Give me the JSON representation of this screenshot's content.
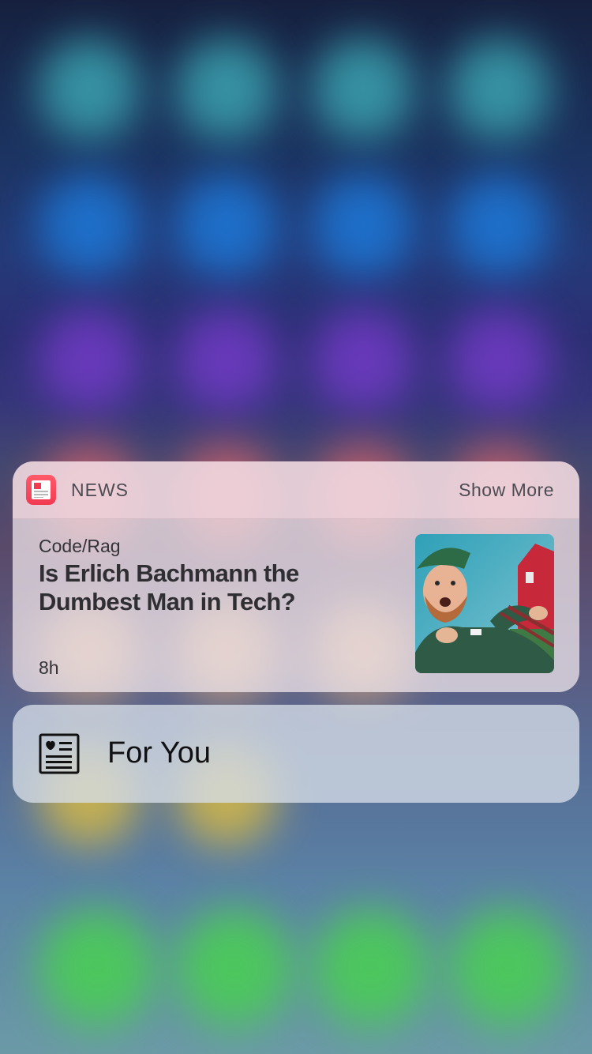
{
  "widget": {
    "app_name": "NEWS",
    "show_more": "Show More",
    "article": {
      "source": "Code/Rag",
      "headline": "Is Erlich Bachmann the Dumbest Man in Tech?",
      "age": "8h"
    }
  },
  "quick_action": {
    "label": "For You",
    "icon": "news-heart-icon"
  },
  "colors": {
    "news_red": "#f23a52",
    "text_dark": "#2f2f33",
    "text_gray": "#4c4c52"
  }
}
